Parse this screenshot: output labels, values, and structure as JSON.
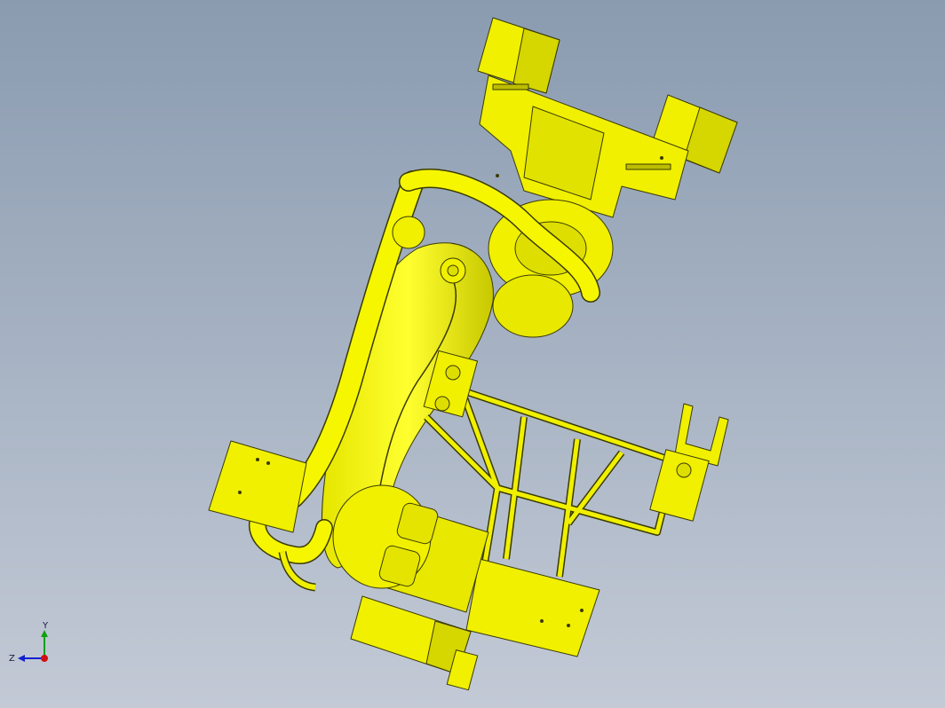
{
  "viewport": {
    "background_top": "#8a9bb0",
    "background_bottom": "#c3cad6"
  },
  "model": {
    "color": "#f0f000",
    "shade": "#c8c800",
    "edge": "#3a3a00"
  },
  "triad": {
    "x_axis_color": "#d01010",
    "y_axis_color": "#10a010",
    "z_axis_color": "#1020d0",
    "y_label": "Y",
    "z_label": "Z"
  }
}
